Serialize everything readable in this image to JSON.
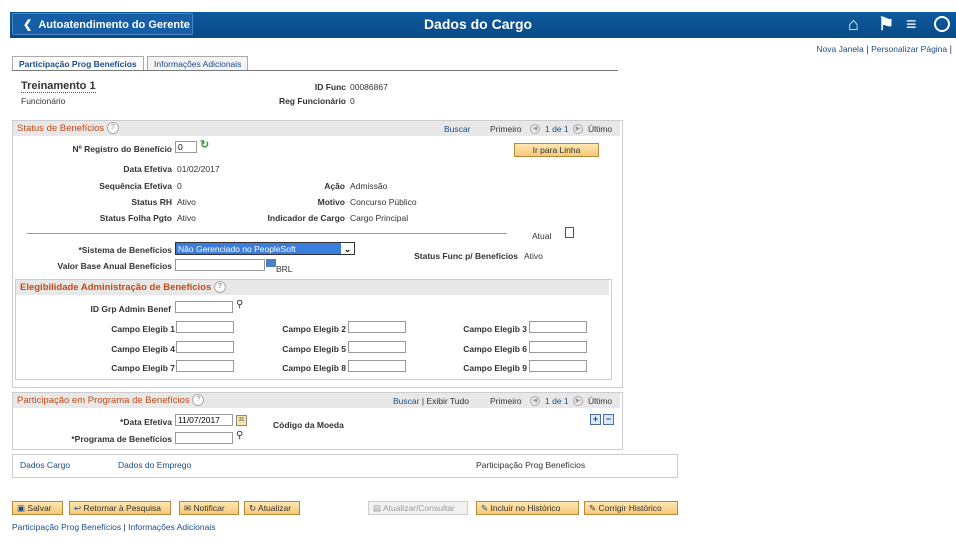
{
  "header": {
    "back_label": "Autoatendimento do Gerente",
    "title": "Dados do Cargo"
  },
  "toplinks": {
    "new_window": "Nova Janela",
    "personalize": "Personalizar Página"
  },
  "tabs": [
    "Participação Prog Benefícios",
    "Informações Adicionais"
  ],
  "employee": {
    "name": "Treinamento 1",
    "role": "Funcionário",
    "id_label": "ID Func",
    "id_value": "00086867",
    "reg_label": "Reg Funcionário",
    "reg_value": "0"
  },
  "status": {
    "title": "Status de Benefícios",
    "search": "Buscar",
    "first": "Primeiro",
    "count": "1 de 1",
    "last": "Último",
    "reg_label": "Nº Registro do Benefício",
    "reg_value": "0",
    "go_line": "Ir para Linha",
    "eff_date_label": "Data Efetiva",
    "eff_date": "01/02/2017",
    "eff_seq_label": "Sequência Efetiva",
    "eff_seq": "0",
    "action_label": "Ação",
    "action": "Admissão",
    "hr_status_label": "Status RH",
    "hr_status": "Ativo",
    "reason_label": "Motivo",
    "reason": "Concurso Público",
    "payroll_label": "Status Folha Pgto",
    "payroll": "Ativo",
    "job_ind_label": "Indicador de Cargo",
    "job_ind": "Cargo Principal",
    "current_label": "Atual",
    "system_label": "*Sistema de Benefícios",
    "system_value": "Não Gerenciado no PeopleSoft",
    "status_func_label": "Status Func p/ Benefícios",
    "status_func": "Ativo",
    "base_label": "Valor Base Anual Benefícios",
    "currency": "BRL"
  },
  "elig": {
    "title": "Elegibilidade Administração de Benefícios",
    "grp_label": "ID Grp Admin Benef",
    "fields": [
      "Campo Elegib 1",
      "Campo Elegib 2",
      "Campo Elegib 3",
      "Campo Elegib 4",
      "Campo Elegib 5",
      "Campo Elegib 6",
      "Campo Elegib 7",
      "Campo Elegib 8",
      "Campo Elegib 9"
    ]
  },
  "program": {
    "title": "Participação em Programa de Benefícios",
    "search": "Buscar",
    "view_all": "Exibir Tudo",
    "first": "Primeiro",
    "count": "1 de 1",
    "last": "Último",
    "date_label": "*Data Efetiva",
    "date_value": "11/07/2017",
    "currency_label": "Código da Moeda",
    "prog_label": "*Programa de Benefícios"
  },
  "footer_links": {
    "job": "Dados Cargo",
    "employment": "Dados do Emprego",
    "current": "Participação Prog Benefícios"
  },
  "toolbar": {
    "save": "Salvar",
    "return": "Retornar à Pesquisa",
    "notify": "Notificar",
    "refresh": "Atualizar",
    "update_view": "Atualizar/Consultar",
    "include_history": "Incluir no Histórico",
    "correct_history": "Corrigir Histórico"
  },
  "bottom_links": {
    "a": "Participação Prog Benefícios",
    "b": "Informações Adicionais"
  }
}
